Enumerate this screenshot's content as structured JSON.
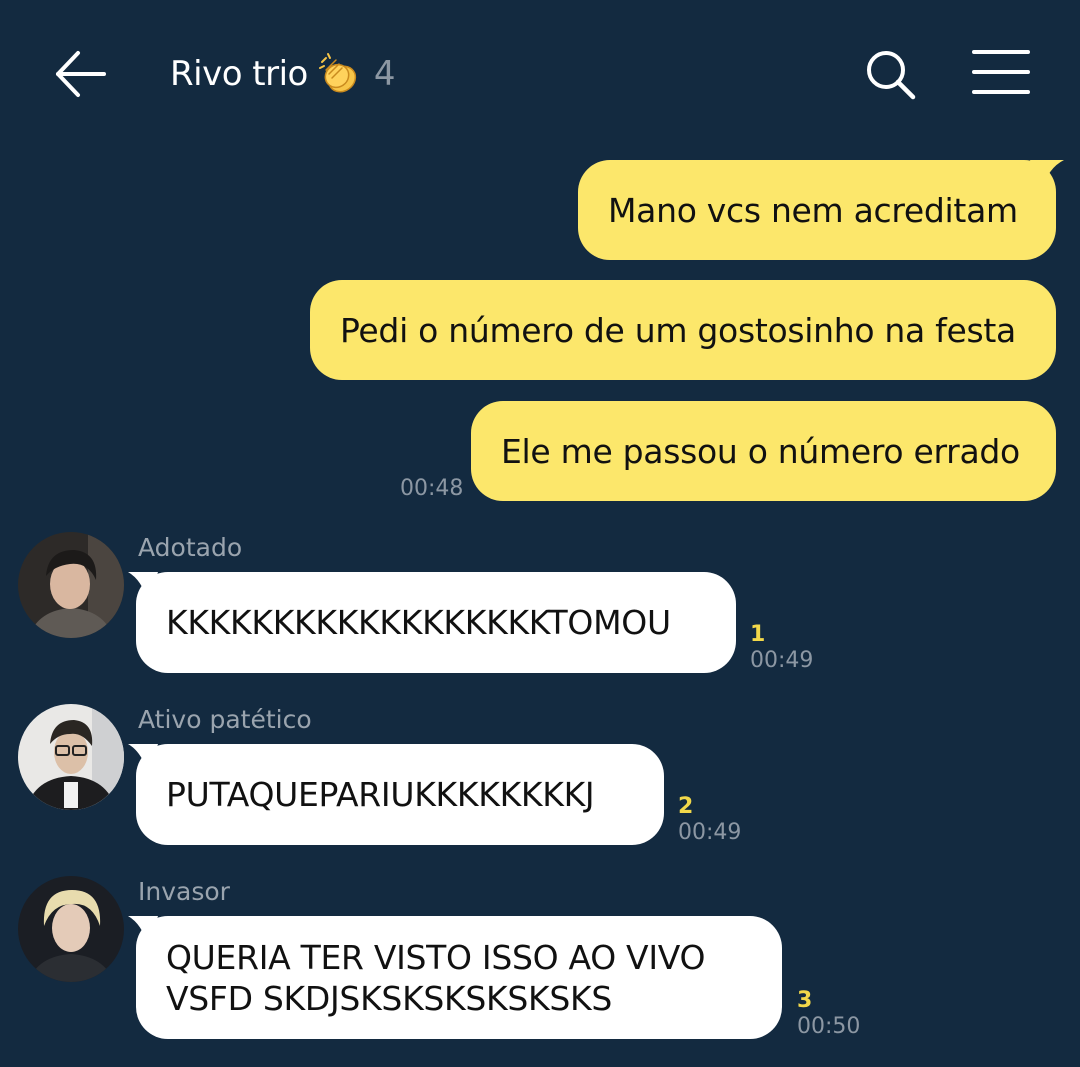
{
  "header": {
    "title": "Rivo trio",
    "title_emoji": "clapping-hands",
    "member_count": "4",
    "back_icon": "back-arrow-icon",
    "search_icon": "search-icon",
    "menu_icon": "menu-icon"
  },
  "outgoing": {
    "messages": [
      {
        "text": "Mano vcs nem acreditam"
      },
      {
        "text": "Pedi o número de um gostosinho na festa"
      },
      {
        "text": "Ele me passou o número errado"
      }
    ],
    "time": "00:48"
  },
  "incoming": [
    {
      "sender": "Adotado",
      "text": "KKKKKKKKKKKKKKKKKKTOMOU",
      "unread": "1",
      "time": "00:49"
    },
    {
      "sender": "Ativo patético",
      "text": "PUTAQUEPARIUKKKKKKKKJ",
      "unread": "2",
      "time": "00:49"
    },
    {
      "sender": "Invasor",
      "lines": [
        "QUERIA TER VISTO ISSO AO VIVO",
        "VSFD SKDJSKSKSKSKSKSKS"
      ],
      "unread": "3",
      "time": "00:50"
    }
  ],
  "colors": {
    "background": "#132a40",
    "outgoing_bubble": "#fce76b",
    "incoming_bubble": "#ffffff",
    "unread_count": "#f2d84a",
    "meta_text": "#8c97a3"
  }
}
